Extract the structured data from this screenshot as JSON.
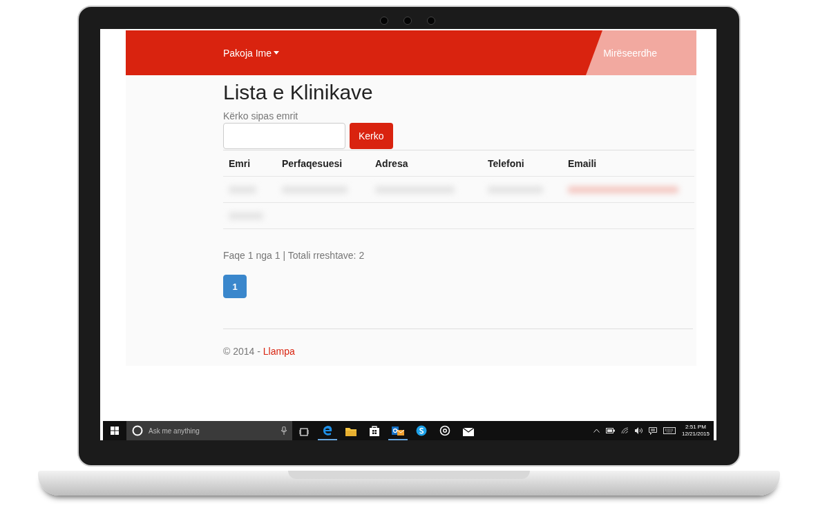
{
  "nav": {
    "menu": "Pakoja Ime",
    "greeting": "Mirëseerdhe"
  },
  "page": {
    "title": "Lista e Klinikave",
    "search_label": "Kërko sipas emrit",
    "search_button": "Kerko"
  },
  "table": {
    "columns": [
      "Emri",
      "Perfaqesuesi",
      "Adresa",
      "Telefoni",
      "Emaili"
    ]
  },
  "paging": {
    "summary": "Faqe 1 nga 1 | Totali rreshtave: 2",
    "pages": [
      {
        "label": "1",
        "selected": true
      }
    ]
  },
  "footer": {
    "prefix": "© 2014 -",
    "link": "Llampa"
  },
  "taskbar": {
    "search_placeholder": "Ask me anything",
    "time": "2:51 PM",
    "date": "12/21/2015",
    "apps": [
      {
        "kind": "taskview",
        "running": false
      },
      {
        "kind": "browser",
        "running": true
      },
      {
        "kind": "folder",
        "running": false
      },
      {
        "kind": "store",
        "running": false
      },
      {
        "kind": "outlook",
        "running": true
      },
      {
        "kind": "chat",
        "running": false
      },
      {
        "kind": "music",
        "running": false
      },
      {
        "kind": "mail",
        "running": false
      }
    ]
  }
}
